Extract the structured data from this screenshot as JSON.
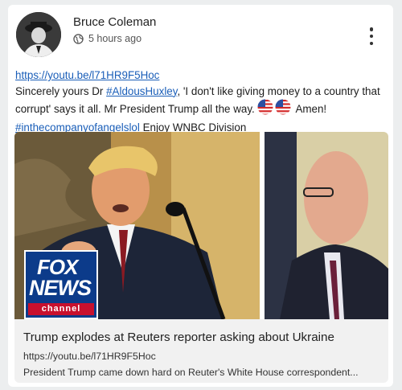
{
  "post": {
    "author": "Bruce Coleman",
    "timestamp": "5 hours ago",
    "audience_icon": "globe-icon",
    "link": "https://youtu.be/l71HR9F5Hoc",
    "text_1": "Sincerely yours Dr ",
    "mention_1": "#AldousHuxley",
    "text_2": ", 'I don't like giving money to a country that corrupt' says it all. Mr President Trump all the way. ",
    "text_3": " Amen! ",
    "hashtag_2": "#inthecompanyofangelslol",
    "text_4": " Enjoy WNBC Division",
    "flags": [
      "us-flag-emoji",
      "us-flag-emoji"
    ]
  },
  "preview": {
    "logo_line1": "FOX",
    "logo_line2": "NEWS",
    "logo_line3": "channel",
    "title": "Trump explodes at Reuters reporter asking about Ukraine",
    "url": "https://youtu.be/l71HR9F5Hoc",
    "description": "President Trump came down hard on Reuter's White House correspondent..."
  },
  "colors": {
    "link": "#1a5eb8",
    "card": "#ffffff",
    "background": "#eceeef",
    "fox_blue": "#0c3b8a"
  }
}
